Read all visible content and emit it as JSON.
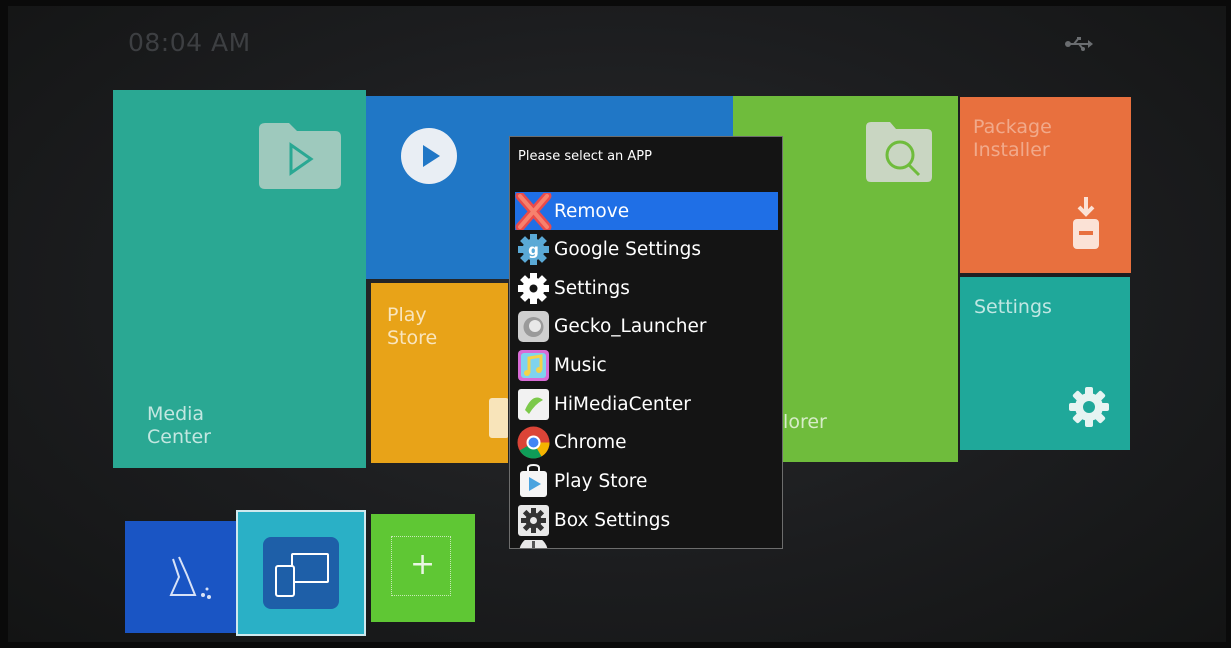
{
  "status_bar": {
    "time": "08:04 AM",
    "usb_icon": "usb-icon"
  },
  "tiles": {
    "media_center": "Media\nCenter",
    "play_store": "Play\nStore",
    "file_explorer": "e\nplorer",
    "package_installer": "Package\nInstaller",
    "settings": "Settings"
  },
  "dialog": {
    "title": "Please select an APP",
    "items": [
      {
        "label": "Remove",
        "icon": "remove-x-icon",
        "selected": true
      },
      {
        "label": "Google Settings",
        "icon": "google-settings-icon"
      },
      {
        "label": "Settings",
        "icon": "settings-gear-icon"
      },
      {
        "label": "Gecko_Launcher",
        "icon": "gecko-launcher-icon"
      },
      {
        "label": "Music",
        "icon": "music-icon"
      },
      {
        "label": "HiMediaCenter",
        "icon": "himediacenter-icon"
      },
      {
        "label": "Chrome",
        "icon": "chrome-icon"
      },
      {
        "label": "Play Store",
        "icon": "play-store-icon"
      },
      {
        "label": "Box Settings",
        "icon": "box-settings-icon"
      },
      {
        "label": "",
        "icon": "partial-item-icon"
      }
    ]
  },
  "colors": {
    "selection": "#1f6fe6",
    "media_tile": "#2aa893",
    "video_tile": "#2077c6",
    "play_tile": "#e8a318",
    "file_tile": "#6fbc3c",
    "package_tile": "#e8703e",
    "settings_tile": "#1fa89a"
  }
}
